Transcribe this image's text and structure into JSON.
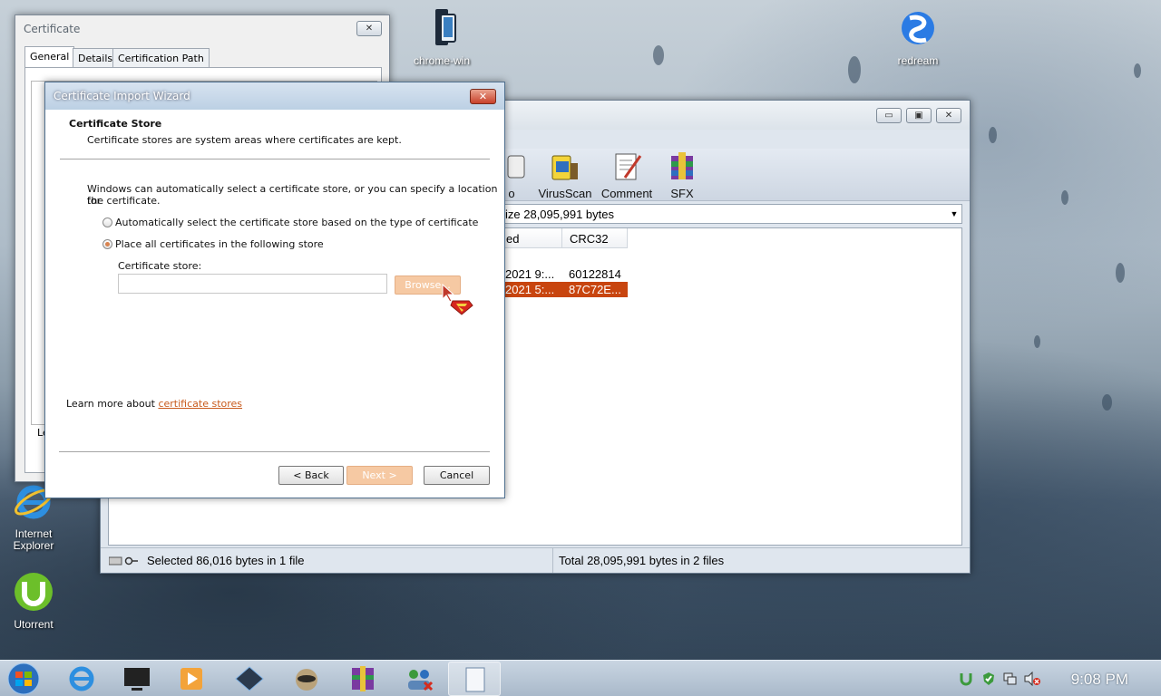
{
  "desktop": {
    "icons": [
      {
        "label": "chrome-win",
        "icon": "chrome-win-icon"
      },
      {
        "label": "redream",
        "icon": "redream-icon"
      },
      {
        "label": "Internet Explorer",
        "icon": "internet-explorer-icon"
      },
      {
        "label": "Utorrent",
        "icon": "utorrent-icon"
      }
    ]
  },
  "winrar": {
    "toolbar": [
      {
        "label": "o"
      },
      {
        "label": "VirusScan"
      },
      {
        "label": "Comment"
      },
      {
        "label": "SFX"
      }
    ],
    "address": "ize 28,095,991 bytes",
    "columns": [
      "ed",
      "CRC32"
    ],
    "rows": [
      {
        "modified": "2021 9:...",
        "crc": "60122814",
        "selected": false
      },
      {
        "modified": "2021 5:...",
        "crc": "87C72E...",
        "selected": true
      }
    ],
    "status_left": "Selected 86,016 bytes in 1 file",
    "status_right": "Total 28,095,991 bytes in 2 files",
    "caption_buttons": {
      "minimize": "▭",
      "maximize": "▣",
      "close": "✕"
    }
  },
  "certificate": {
    "title": "Certificate",
    "tabs": [
      "General",
      "Details",
      "Certification Path"
    ],
    "close": "✕",
    "partial_text": "Le"
  },
  "wizard": {
    "title": "Certificate Import Wizard",
    "close": "✕",
    "heading": "Certificate Store",
    "subheading": "Certificate stores are system areas where certificates are kept.",
    "intro_line1": "Windows can automatically select a certificate store, or you can specify a location for",
    "intro_line2": "the certificate.",
    "option_auto": "Automatically select the certificate store based on the type of certificate",
    "option_manual": "Place all certificates in the following store",
    "selected_option": "manual",
    "store_label": "Certificate store:",
    "store_value": "",
    "browse": "Browse...",
    "learn_prefix": "Learn more about ",
    "learn_link": "certificate stores",
    "back": "< Back",
    "next": "Next >",
    "cancel": "Cancel"
  },
  "taskbar": {
    "clock": "9:08 PM",
    "apps": [
      "start-orb-icon",
      "internet-explorer-icon",
      "media-center-icon",
      "media-player-icon",
      "game-icon",
      "raccoon-icon",
      "winrar-icon",
      "network-users-icon",
      "document-icon"
    ],
    "tray": [
      "utorrent-tray-icon",
      "antivirus-tray-icon",
      "network-tray-icon",
      "volume-muted-icon"
    ]
  },
  "colors": {
    "selection": "#c8450f",
    "link": "#c85a1c",
    "disabled_button": "#f6c9a3"
  }
}
